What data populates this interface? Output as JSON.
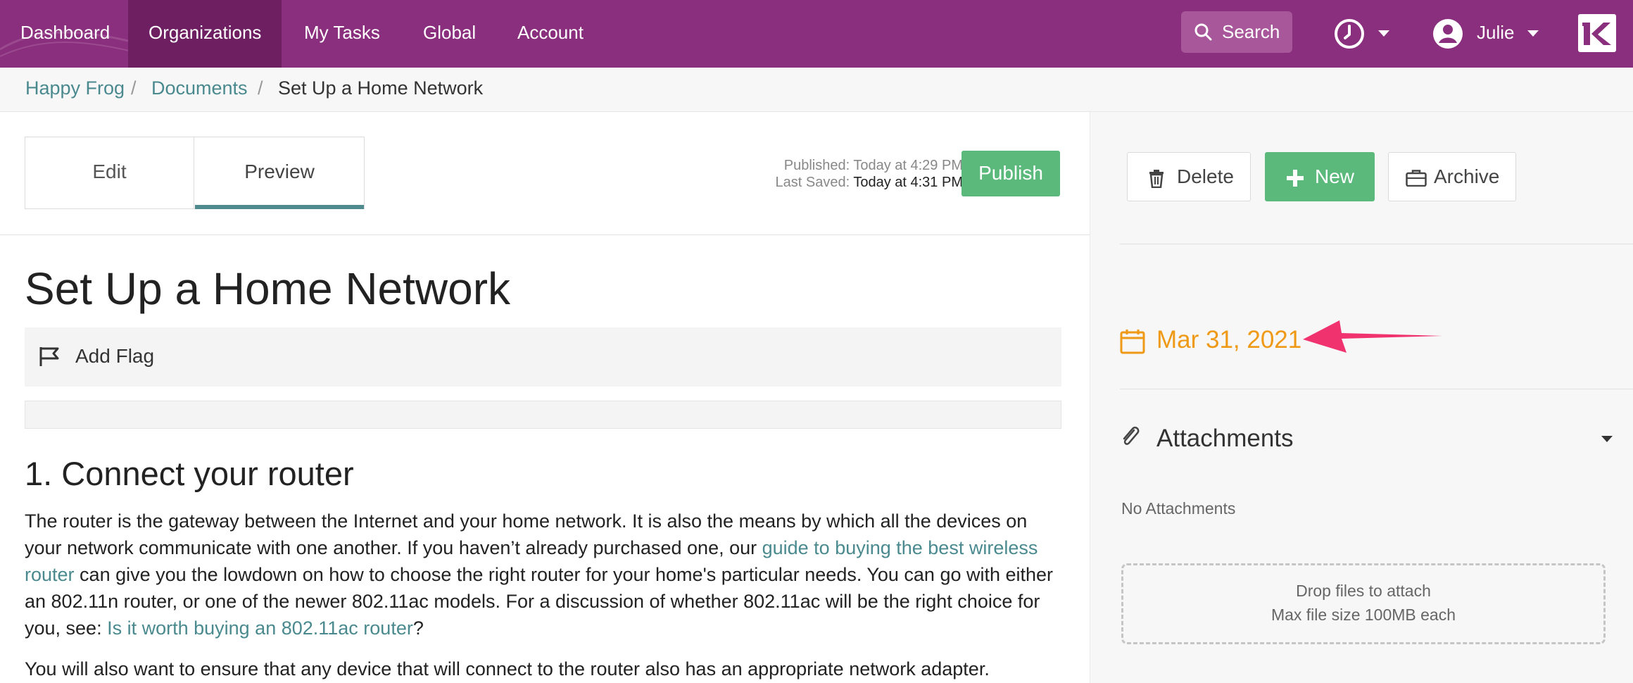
{
  "nav": {
    "items": [
      {
        "label": "Dashboard",
        "active": false
      },
      {
        "label": "Organizations",
        "active": true
      },
      {
        "label": "My Tasks",
        "active": false
      },
      {
        "label": "Global",
        "active": false
      },
      {
        "label": "Account",
        "active": false
      }
    ],
    "search_label": "Search",
    "user_name": "Julie",
    "logo_icon": "k-logo-icon"
  },
  "breadcrumb": {
    "items": [
      "Happy Frog",
      "Documents"
    ],
    "current": "Set Up a Home Network"
  },
  "editor": {
    "tabs": [
      "Edit",
      "Preview"
    ],
    "active_tab": "Preview",
    "published_label": "Published:",
    "published_value": "Today at 4:29 PM",
    "saved_label": "Last Saved:",
    "saved_value": "Today at 4:31 PM",
    "publish_button": "Publish"
  },
  "document": {
    "title": "Set Up a Home Network",
    "flag_label": "Add Flag",
    "section_heading": "1. Connect your router",
    "p1_a": "The router is the gateway between the Internet and your home network. It is also the means by which all the devices on your network communicate with one another. If you haven’t already purchased one, our ",
    "p1_link1": "guide to buying the best wireless router",
    "p1_b": " can give you the lowdown on how to choose the right router for your home's particular needs. You can go with either an 802.11n router, or one of the newer 802.11ac models. For a discussion of whether 802.11ac will be the right choice for you, see: ",
    "p1_link2": "Is it worth buying an 802.11ac router",
    "p1_c": "?",
    "p2": "You will also want to ensure that any device that will connect to the router also has an appropriate network adapter."
  },
  "sidebar": {
    "delete_label": "Delete",
    "new_label": "New",
    "archive_label": "Archive",
    "date": "Mar 31, 2021",
    "attachments_title": "Attachments",
    "no_attachments": "No Attachments",
    "drop_line1": "Drop files to attach",
    "drop_line2": "Max file size 100MB each"
  },
  "colors": {
    "nav_bg": "#8a2f7d",
    "accent_green": "#5bb97b",
    "link_teal": "#4a8a8f",
    "date_orange": "#ef9a16",
    "annotation_pink": "#f0336f"
  }
}
